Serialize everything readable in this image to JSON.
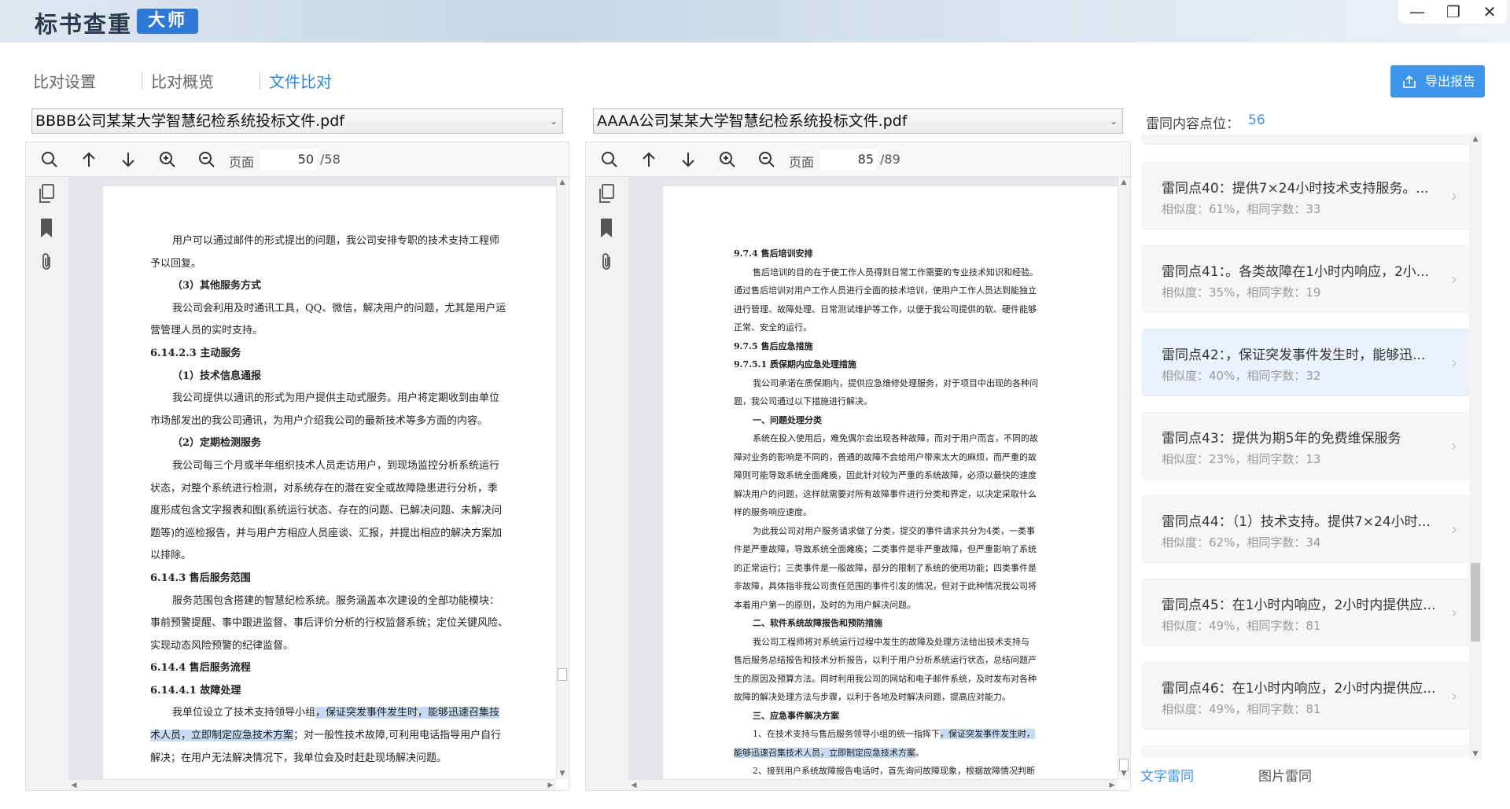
{
  "app": {
    "title": "标书查重",
    "badge": "大师"
  },
  "window": {
    "min": "—",
    "restore": "❐",
    "close": "✕"
  },
  "tabs": [
    {
      "label": "比对设置"
    },
    {
      "label": "比对概览"
    },
    {
      "label": "文件比对"
    }
  ],
  "export_label": "导出报告",
  "left": {
    "file": "BBBB公司某某大学智慧纪检系统投标文件.pdf",
    "page_label": "页面",
    "page": "50",
    "total": "/58",
    "lines": [
      "用户可以通过邮件的形式提出的问题，我公司安排专职的技术支持工程师",
      "予以回复。",
      "（3）其他服务方式",
      "我公司会利用及时通讯工具，QQ、微信，解决用户的问题，尤其是用户运",
      "营管理人员的实时支持。",
      "6.14.2.3 主动服务",
      "（1）技术信息通报",
      "我公司提供以通讯的形式为用户提供主动式服务。用户将定期收到由单位",
      "市场部发出的我公司通讯，为用户介绍我公司的最新技术等多方面的内容。",
      "（2）定期检测服务",
      "我公司每三个月或半年组织技术人员走访用户，到现场监控分析系统运行",
      "状态，对整个系统进行检测，对系统存在的潜在安全或故障隐患进行分析，季",
      "度形成包含文字报表和图(系统运行状态、存在的问题、已解决问题、未解决问",
      "题等)的巡检报告，并与用户方相应人员座谈、汇报，并提出相应的解决方案加",
      "以排除。",
      "6.14.3    售后服务范围",
      "服务范围包含搭建的智慧纪检系统。服务涵盖本次建设的全部功能模块：",
      "事前预警提醒、事中跟进监督、事后评价分析的行权监督系统；定位关键风险、",
      "实现动态风险预警的纪律监督。",
      "6.14.4    售后服务流程",
      "6.14.4.1 故障处理",
      "我单位设立了技术支持领导小组",
      "，保证突发事件发生时，能够迅速召集技",
      "术人员，立即制定应急技术方案",
      "；对一般性技术故障,可利用电话指导用户自行",
      "解决；在用户无法解决情况下，我单位会及时赶赴现场解决问题。"
    ]
  },
  "right": {
    "file": "AAAA公司某某大学智慧纪检系统投标文件.pdf",
    "page_label": "页面",
    "page": "85",
    "total": "/89",
    "lines": [
      "9.7.4 售后培训安排",
      "售后培训的目的在于使工作人员得到日常工作需要的专业技术知识和经验。",
      "通过售后培训对用户工作人员进行全面的技术培训，使用户工作人员达到能独立",
      "进行管理、故障处理、日常测试维护等工作，以便于我公司提供的软、硬件能够",
      "正常、安全的运行。",
      "9.7.5 售后应急措施",
      "9.7.5.1 质保期内应急处理措施",
      "我公司承诺在质保期内，提供应急维修处理服务，对于项目中出现的各种问",
      "题，我公司通过以下措施进行解决。",
      "一、问题处理分类",
      "系统在投入使用后，难免偶尔会出现各种故障，而对于用户而言，不同的故",
      "障对业务的影响是不同的，普通的故障不会给用户带来太大的麻烦，而严重的故",
      "障则可能导致系统全面瘫痪，因此针对较为严重的系统故障，必须以最快的速度",
      "解决用户的问题，这样就需要对所有故障事件进行分类和界定，以决定采取什么",
      "样的服务响应速度。",
      "为此我公司对用户服务请求做了分类，提交的事件请求共分为4类，一类事",
      "件是严重故障，导致系统全面瘫痪；二类事件是非严重故障，但严重影响了系统",
      "的正常运行；三类事件是一般故障，部分的限制了系统的使用功能；四类事件是",
      "非故障，具体指非我公司责任范围的事件引发的情况，但对于此种情况我公司将",
      "本着用户第一的原则，及时的为用户解决问题。",
      "二、软件系统故障报告和预防措施",
      "我公司工程师将对系统运行过程中发生的故障及处理方法给出技术支持与",
      "售后服务总结报告和技术分析报告，以利于用户分析系统运行状态，总结问题产",
      "生的原因及预算方法。同时利用我公司的网站和电子邮件系统，及时发布对各种",
      "故障的解决处理方法与步骤，以利于各地及时解决问题，提高应对能力。",
      "三、应急事件解决方案",
      "1、在技术支持与售后服务领导小组的统一指挥下",
      "，保证突发事件发生时，",
      "能够迅速召集技术人员，立即制定应急技术方案",
      "。",
      "2、接到用户系统故障报告电话时，首先询问故障现象，根据故障情况判断"
    ]
  },
  "results": {
    "label": "雷同内容点位：",
    "count": "56",
    "items": [
      {
        "title": "雷同点40：提供7×24小时技术支持服务。...",
        "sub": "相似度：61%，相同字数：33"
      },
      {
        "title": "雷同点41：。各类故障在1小时内响应，2小...",
        "sub": "相似度：35%，相同字数：19"
      },
      {
        "title": "雷同点42：，保证突发事件发生时，能够迅...",
        "sub": "相似度：40%，相同字数：32"
      },
      {
        "title": "雷同点43：提供为期5年的免费维保服务",
        "sub": "相似度：23%，相同字数：13"
      },
      {
        "title": "雷同点44：（1）技术支持。提供7×24小时...",
        "sub": "相似度：62%，相同字数：34"
      },
      {
        "title": "雷同点45：在1小时内响应，2小时内提供应...",
        "sub": "相似度：49%，相同字数：81"
      },
      {
        "title": "雷同点46：在1小时内响应，2小时内提供应...",
        "sub": "相似度：49%，相同字数：81"
      }
    ],
    "tab_text": "文字雷同",
    "tab_image": "图片雷同"
  },
  "colors": {
    "accent": "#3c95e8",
    "highlight": "#c9dbf2",
    "badge": "#2f78d6"
  }
}
